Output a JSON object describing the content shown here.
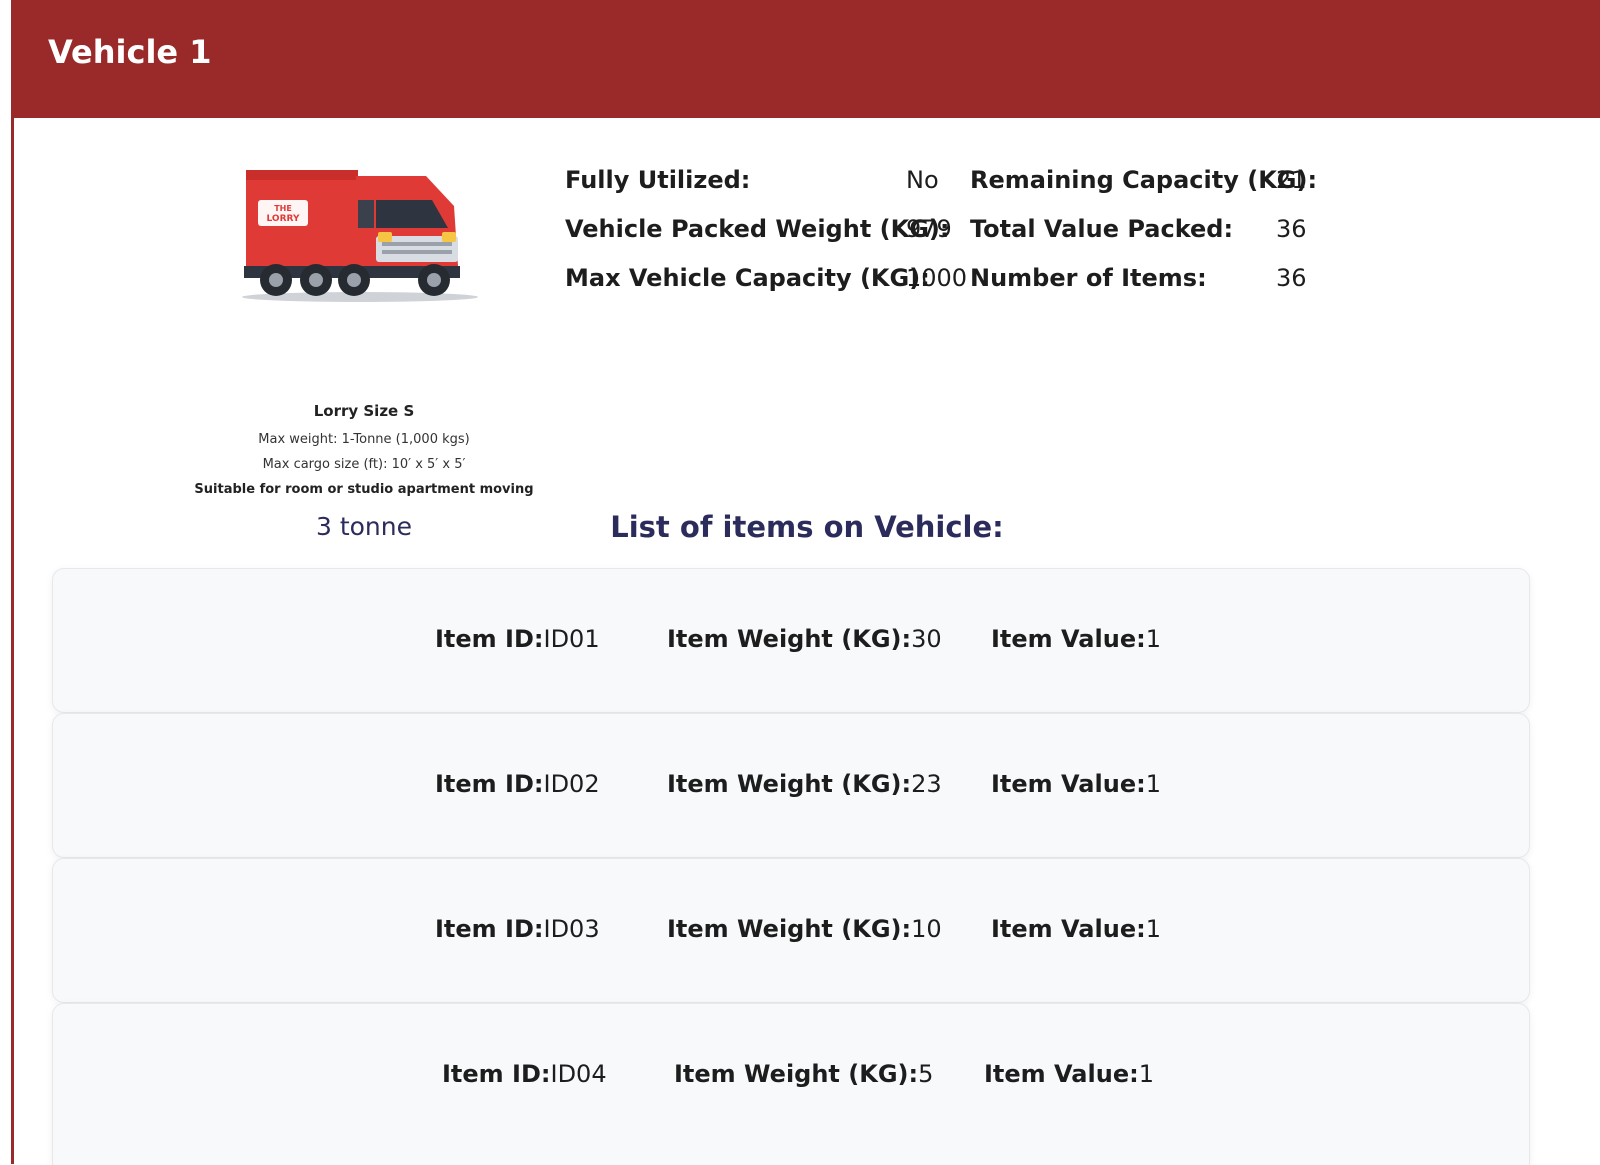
{
  "header": {
    "title": "Vehicle 1"
  },
  "truck": {
    "icon": "truck-icon",
    "brand_text": "THE LORRY .COM",
    "size_title": "Lorry Size S",
    "max_weight": "Max weight: 1-Tonne (1,000 kgs)",
    "max_cargo": "Max cargo size (ft): 10′ x 5′ x 5′",
    "suitable": "Suitable for room or studio apartment moving",
    "tonnage": "3 tonne",
    "color": "#e03a36"
  },
  "stats": {
    "fully_utilized": {
      "label": "Fully Utilized:",
      "value": "No"
    },
    "packed_weight": {
      "label": "Vehicle Packed Weight (KG):",
      "value": "979"
    },
    "max_capacity": {
      "label": "Max Vehicle Capacity (KG):",
      "value": "1000"
    },
    "remaining_capacity": {
      "label": "Remaining Capacity (KG):",
      "value": "21"
    },
    "total_value": {
      "label": "Total Value Packed:",
      "value": "36"
    },
    "number_of_items": {
      "label": "Number of Items:",
      "value": "36"
    }
  },
  "list": {
    "title": "List of items on Vehicle:",
    "id_label": "Item ID:",
    "weight_label": "Item Weight (KG):",
    "value_label": "Item Value:",
    "items": [
      {
        "id": "ID01",
        "weight": "30",
        "value": "1"
      },
      {
        "id": "ID02",
        "weight": "23",
        "value": "1"
      },
      {
        "id": "ID03",
        "weight": "10",
        "value": "1"
      },
      {
        "id": "ID04",
        "weight": "5",
        "value": "1"
      }
    ]
  },
  "colors": {
    "header_bg": "#9a2a2a",
    "title_navy": "#2c2c5c",
    "card_bg": "#f8f9fb"
  }
}
